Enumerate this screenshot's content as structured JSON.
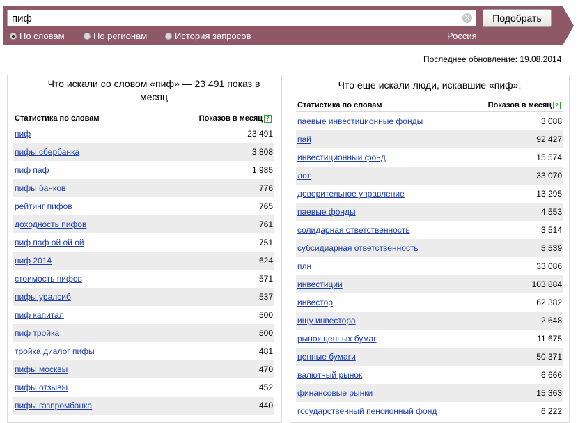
{
  "search": {
    "value": "пиф",
    "clear_icon": "clear-icon",
    "submit_label": "Подобрать"
  },
  "modes": [
    {
      "label": "По словам",
      "selected": true
    },
    {
      "label": "По регионам",
      "selected": false
    },
    {
      "label": "История запросов",
      "selected": false
    }
  ],
  "region": "Россия",
  "last_update": "Последнее обновление: 19.08.2014",
  "left_panel": {
    "title_line1": "Что искали со словом «пиф» — 23 491 показ в",
    "title_line2": "месяц",
    "col_words": "Статистика по словам",
    "col_count": "Показов в месяц",
    "help_icon": "?",
    "rows": [
      {
        "phrase": "пиф",
        "count": "23 491"
      },
      {
        "phrase": "пифы сбербанка",
        "count": "3 808"
      },
      {
        "phrase": "пиф паф",
        "count": "1 985"
      },
      {
        "phrase": "пифы банков",
        "count": "776"
      },
      {
        "phrase": "рейтинг пифов",
        "count": "765"
      },
      {
        "phrase": "доходность пифов",
        "count": "761"
      },
      {
        "phrase": "пиф паф ой ой ой",
        "count": "751"
      },
      {
        "phrase": "пиф 2014",
        "count": "624"
      },
      {
        "phrase": "стоимость пифов",
        "count": "571"
      },
      {
        "phrase": "пифы уралсиб",
        "count": "537"
      },
      {
        "phrase": "пиф капитал",
        "count": "500"
      },
      {
        "phrase": "пиф тройка",
        "count": "500"
      },
      {
        "phrase": "тройка диалог пифы",
        "count": "481"
      },
      {
        "phrase": "пифы москвы",
        "count": "470"
      },
      {
        "phrase": "пифы отзывы",
        "count": "452"
      },
      {
        "phrase": "пифы газпромбанка",
        "count": "440"
      }
    ]
  },
  "right_panel": {
    "title": "Что еще искали люди, искавшие «пиф»:",
    "col_words": "Статистика по словам",
    "col_count": "Показов в месяц",
    "help_icon": "?",
    "rows": [
      {
        "phrase": "паевые инвестиционные фонды",
        "count": "3 088"
      },
      {
        "phrase": "пай",
        "count": "92 427"
      },
      {
        "phrase": "инвестиционный фонд",
        "count": "15 574"
      },
      {
        "phrase": "лот",
        "count": "33 070"
      },
      {
        "phrase": "доверительное управление",
        "count": "13 295"
      },
      {
        "phrase": "паевые фонды",
        "count": "4 553"
      },
      {
        "phrase": "солидарная ответственность",
        "count": "3 514"
      },
      {
        "phrase": "субсидиарная ответственность",
        "count": "5 539"
      },
      {
        "phrase": "плн",
        "count": "33 086"
      },
      {
        "phrase": "инвестиции",
        "count": "103 884"
      },
      {
        "phrase": "инвестор",
        "count": "62 382"
      },
      {
        "phrase": "ищу инвестора",
        "count": "2 648"
      },
      {
        "phrase": "рынок ценных бумаг",
        "count": "11 675"
      },
      {
        "phrase": "ценные бумаги",
        "count": "50 371"
      },
      {
        "phrase": "валютный рынок",
        "count": "6 666"
      },
      {
        "phrase": "финансовые рынки",
        "count": "15 363"
      },
      {
        "phrase": "государственный пенсионный фонд",
        "count": "6 222"
      }
    ]
  }
}
